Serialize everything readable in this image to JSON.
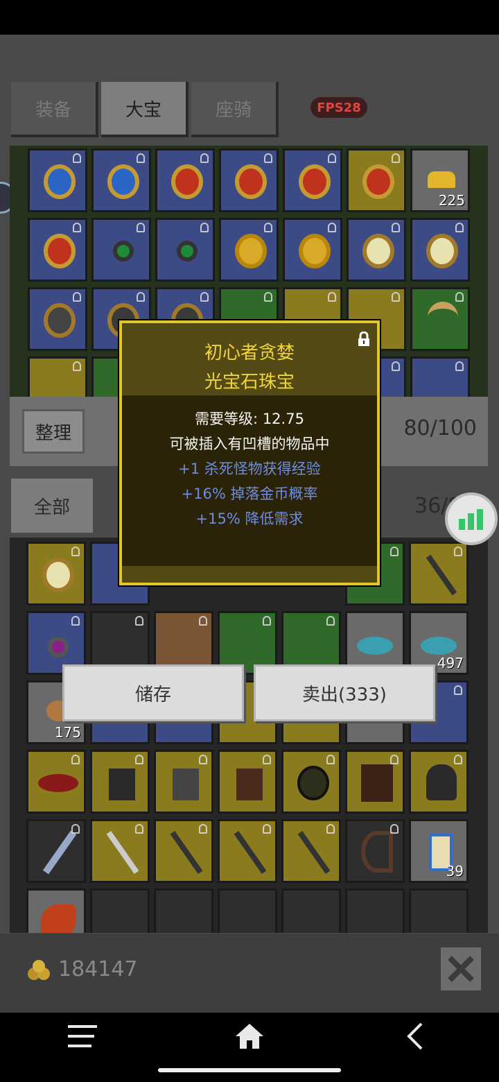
{
  "tabs": [
    {
      "label": "装备",
      "active": false
    },
    {
      "label": "大宝",
      "active": true
    },
    {
      "label": "座骑",
      "active": false
    }
  ],
  "fps": "FPS28",
  "inventory": {
    "sort_label": "整理",
    "capacity": "80/100",
    "top_counts": {
      "ore": "225"
    }
  },
  "filter": {
    "all_label": "全部",
    "capacity": "36/8"
  },
  "tooltip": {
    "name_line1": "初心者贪婪",
    "name_line2": "光宝石珠宝",
    "requirement": "需要等级: 12.75",
    "socket_note": "可被插入有凹槽的物品中",
    "stat1": "+1 杀死怪物获得经验",
    "stat2": "+16% 掉落金币概率",
    "stat3": "+15% 降低需求"
  },
  "actions": {
    "store_label": "储存",
    "sell_label": "卖出(333)"
  },
  "bag_counts": {
    "fish": "497",
    "pouch": "175",
    "scroll": "39"
  },
  "gold": "184147",
  "colors": {
    "tooltip_border": "#e4c629",
    "tooltip_title": "#f2d43c",
    "stat_blue": "#6f8de0",
    "fps_red": "#e0463d"
  }
}
